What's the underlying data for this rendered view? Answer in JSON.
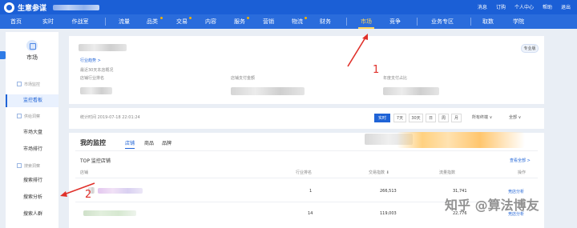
{
  "header": {
    "brand": "生意参谋",
    "links": [
      "消息",
      "订购",
      "个人中心",
      "帮助",
      "退出"
    ]
  },
  "nav": {
    "items": [
      "首页",
      "实时",
      "作战室",
      "流量",
      "品类",
      "交易",
      "内容",
      "服务",
      "营销",
      "物流",
      "财务",
      "市场",
      "竞争",
      "业务专区",
      "取数",
      "学院"
    ],
    "active": "市场"
  },
  "sidebar": {
    "title": "市场",
    "groups": [
      "市场监控",
      "供给洞察",
      "搜索洞察"
    ],
    "items": [
      "监控看板",
      "市场大盘",
      "市场排行",
      "搜索排行",
      "搜索分析",
      "搜索人群"
    ],
    "active": "监控看板"
  },
  "card1": {
    "badge": "专业版",
    "breadcrumb": "行业趋势 >",
    "note": "最近30天本店概况",
    "metric1": "店铺行业排名",
    "metric2": "店铺支付金额",
    "metric3": "年度支付占比"
  },
  "card2": {
    "stat_time": "统计时间 2019-07-18 22:01:24",
    "range_buttons": [
      "实时",
      "7天",
      "30天",
      "日",
      "周",
      "月"
    ],
    "terminal": "所有终端 ∨",
    "all": "全部 ∨"
  },
  "card3": {
    "title": "我的监控",
    "tabs": [
      "店铺",
      "商品",
      "品牌"
    ],
    "subtitle": "TOP 监控店铺",
    "view_all": "查看全部 >",
    "columns": [
      "店铺",
      "行业排名",
      "交易指数 ⬇",
      "流量指数",
      "操作"
    ],
    "rows": [
      {
        "rank": "1",
        "trade": "266,513",
        "traffic": "31,741",
        "action": "竞店分析"
      },
      {
        "rank": "14",
        "trade": "119,003",
        "traffic": "22,776",
        "action": "竞店分析"
      }
    ]
  },
  "annotations": {
    "label1": "1",
    "label2": "2"
  },
  "watermark": "知乎 @算法博友",
  "colors": {
    "nav": "#2a6cdc",
    "topbar": "#1b5fd6",
    "accent": "#1f63d6",
    "highlight": "#ffd65a",
    "annotation": "#e0302a"
  }
}
